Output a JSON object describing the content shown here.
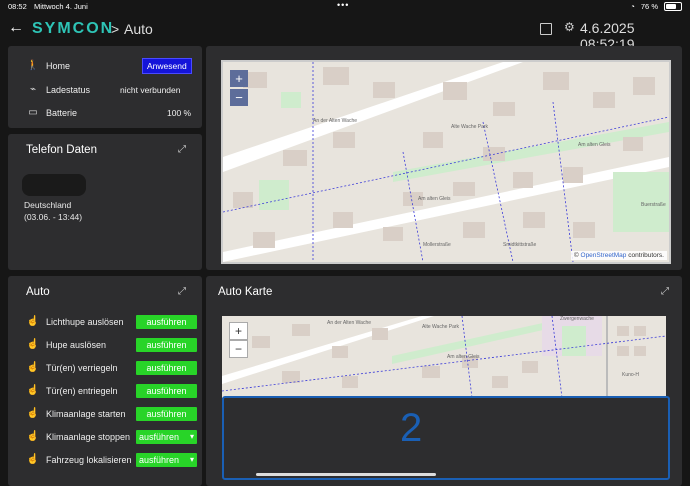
{
  "status_bar": {
    "time": "08:52",
    "date": "Mittwoch 4. Juni",
    "battery": "76 %"
  },
  "header": {
    "logo": "SYMCON",
    "breadcrumb_sep": ">",
    "title": "Auto",
    "datetime": "4.6.2025 08:52:19"
  },
  "home_card": {
    "rows": [
      {
        "label": "Home",
        "badge": "Anwesend"
      },
      {
        "label": "Ladestatus",
        "value": "nicht verbunden"
      },
      {
        "label": "Batterie",
        "value": "100 %"
      }
    ]
  },
  "phone_card": {
    "title": "Telefon Daten",
    "country": "Deutschland",
    "timestamp": "(03.06. - 13:44)"
  },
  "auto_card": {
    "title": "Auto",
    "rows": [
      {
        "label": "Lichthupe auslösen",
        "button": "ausführen"
      },
      {
        "label": "Hupe auslösen",
        "button": "ausführen"
      },
      {
        "label": "Tür(en) verriegeln",
        "button": "ausführen"
      },
      {
        "label": "Tür(en) entriegeln",
        "button": "ausführen"
      },
      {
        "label": "Klimaanlage starten",
        "button": "ausführen"
      },
      {
        "label": "Klimaanlage stoppen",
        "button": "ausführen"
      },
      {
        "label": "Fahrzeug lokalisieren",
        "button": "ausführen"
      }
    ]
  },
  "map_top": {
    "zoom_in": "+",
    "zoom_out": "−",
    "attribution_prefix": "©",
    "attribution_link": "OpenStreetMap",
    "attribution_suffix": "contributors.",
    "labels": [
      "An der Alten Wache",
      "Alte Wache Park",
      "Am alten Gleis",
      "Am alten Gleis",
      "Mollerstraße",
      "Smidtkittstraße",
      "Buerstraße"
    ]
  },
  "auto_map_card": {
    "title": "Auto Karte",
    "zoom_in": "+",
    "zoom_out": "−",
    "labels": [
      "An der Alten Wache",
      "Alte Wache Park",
      "Am alten Gleis",
      "Kuno-H",
      "Zwergenwache"
    ],
    "overlay_number": "2"
  },
  "colors": {
    "accent": "#2ec4b6",
    "button": "#28d428",
    "badge": "#1414d9",
    "overlay_border": "#1a5fb4"
  }
}
